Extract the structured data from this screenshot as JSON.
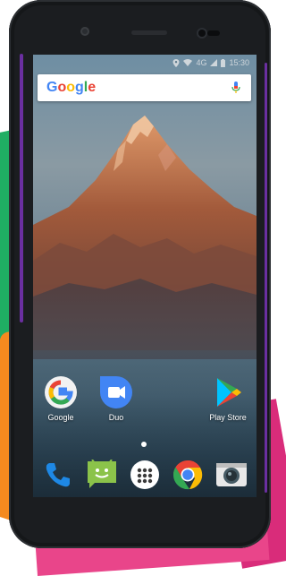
{
  "status_bar": {
    "network": "4G",
    "time": "15:30",
    "icons": [
      "location-icon",
      "wifi-icon",
      "signal-icon",
      "battery-icon"
    ]
  },
  "search": {
    "logo": "Google",
    "icon": "microphone-icon"
  },
  "home_apps": [
    {
      "label": "Google",
      "icon": "google-icon"
    },
    {
      "label": "Duo",
      "icon": "duo-icon"
    },
    {
      "label": "Play Store",
      "icon": "play-store-icon"
    }
  ],
  "dock": [
    {
      "icon": "phone-icon"
    },
    {
      "icon": "messaging-icon"
    },
    {
      "icon": "app-drawer-icon"
    },
    {
      "icon": "chrome-icon"
    },
    {
      "icon": "camera-icon"
    }
  ],
  "colors": {
    "phone_body": "#1b1d20",
    "accent_edge": "#6a2fa0",
    "google_blue": "#4285f4",
    "google_red": "#ea4335",
    "google_yellow": "#fbbc05",
    "google_green": "#34a853"
  }
}
